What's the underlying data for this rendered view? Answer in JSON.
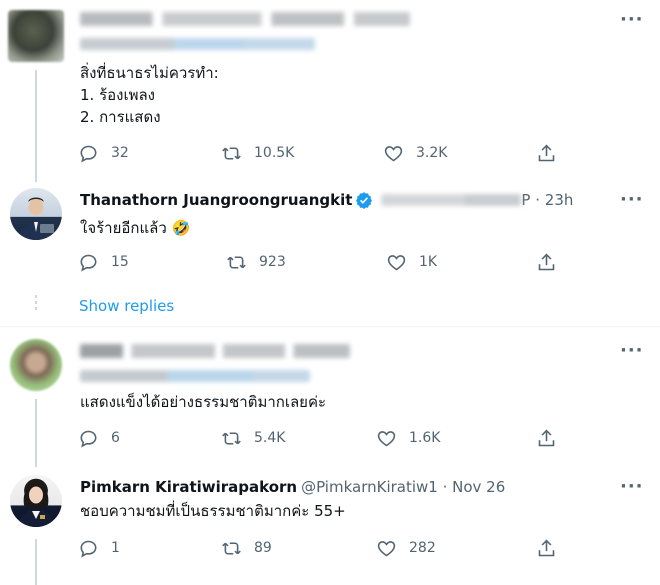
{
  "tweets": [
    {
      "blurred": true,
      "text_lines": [
        "สิ่งที่ธนาธรไม่ควรทำ:",
        "1. ร้องเพลง",
        "2. การแสดง"
      ],
      "replies": "32",
      "retweets": "10.5K",
      "likes": "3.2K"
    },
    {
      "name": "Thanathorn Juangroongruangkit",
      "handle_suffix": "P · 23h",
      "text": "ใจร้ายอีกแล้ว 🤣",
      "replies": "15",
      "retweets": "923",
      "likes": "1K"
    },
    {
      "blurred": true,
      "text": "แสดงแข็งได้อย่างธรรมชาติมากเลยค่ะ",
      "replies": "6",
      "retweets": "5.4K",
      "likes": "1.6K"
    },
    {
      "name": "Pimkarn Kiratiwirapakorn",
      "handle": "@PimkarnKiratiw1 · Nov 26",
      "text": "ชอบความชมที่เป็นธรรมชาติมากค่ะ 55+",
      "replies": "1",
      "retweets": "89",
      "likes": "282"
    }
  ],
  "show_replies": "Show replies",
  "colors": {
    "accent": "#1d9bf0",
    "secondary_text": "#536471",
    "divider": "#eff3f4"
  }
}
